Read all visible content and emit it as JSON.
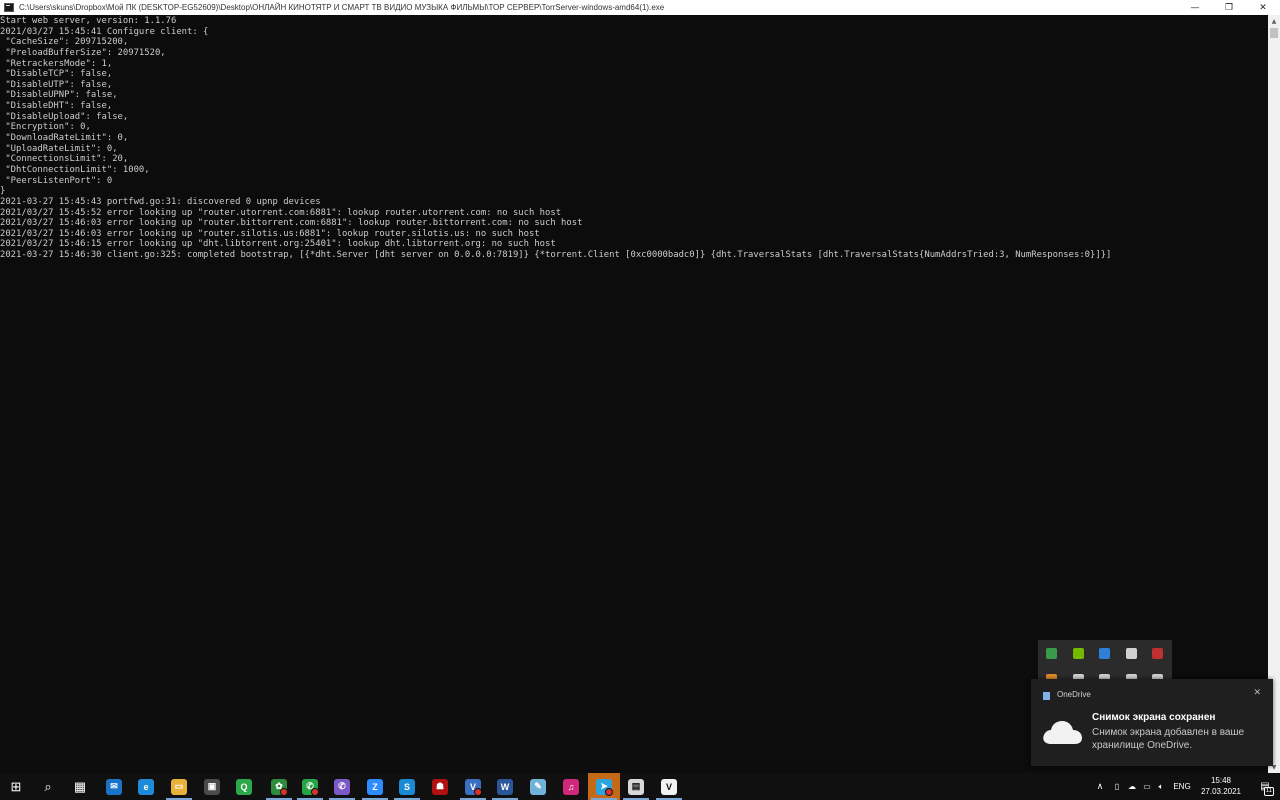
{
  "window": {
    "title": "C:\\Users\\skuns\\Dropbox\\Мой ПК (DESKTOP-EG52609)\\Desktop\\ОНЛАЙН   КИНОТЯТР  И СМАРТ ТВ  ВИДИО МУЗЫКА  ФИЛЬМЫ\\ТОР СЕРВЕР\\TorrServer-windows-amd64(1).exe",
    "controls": {
      "minimize": "—",
      "maximize": "❐",
      "close": "✕"
    }
  },
  "console": {
    "lines": [
      "Start web server, version: 1.1.76",
      "2021/03/27 15:45:41 Configure client: {",
      " \"CacheSize\": 209715200,",
      " \"PreloadBufferSize\": 20971520,",
      " \"RetrackersMode\": 1,",
      " \"DisableTCP\": false,",
      " \"DisableUTP\": false,",
      " \"DisableUPNP\": false,",
      " \"DisableDHT\": false,",
      " \"DisableUpload\": false,",
      " \"Encryption\": 0,",
      " \"DownloadRateLimit\": 0,",
      " \"UploadRateLimit\": 0,",
      " \"ConnectionsLimit\": 20,",
      " \"DhtConnectionLimit\": 1000,",
      " \"PeersListenPort\": 0",
      "}",
      "2021-03-27 15:45:43 portfwd.go:31: discovered 0 upnp devices",
      "2021/03/27 15:45:52 error looking up \"router.utorrent.com:6881\": lookup router.utorrent.com: no such host",
      "2021/03/27 15:46:03 error looking up \"router.bittorrent.com:6881\": lookup router.bittorrent.com: no such host",
      "2021/03/27 15:46:03 error looking up \"router.silotis.us:6881\": lookup router.silotis.us: no such host",
      "2021/03/27 15:46:15 error looking up \"dht.libtorrent.org:25401\": lookup dht.libtorrent.org: no such host",
      "2021-03-27 15:46:30 client.go:325: completed bootstrap, [{*dht.Server [dht server on 0.0.0.0:7819]} {*torrent.Client [0xc0000badc0]} {dht.TraversalStats [dht.TraversalStats{NumAddrsTried:3, NumResponses:0}]}]"
    ]
  },
  "toast": {
    "app_name": "OneDrive",
    "close": "✕",
    "title": "Снимок экрана сохранен",
    "body": "Снимок экрана добавлен в ваше хранилище OneDrive."
  },
  "tray_popup": {
    "icons": [
      "shield-icon",
      "nvidia-icon",
      "bluetooth-icon",
      "defender-icon",
      "antivirus-icon"
    ],
    "colors": [
      "#3a9a4a",
      "#76b900",
      "#2f7fd8",
      "#d0d0d0",
      "#c03030"
    ]
  },
  "taskbar": {
    "apps": [
      {
        "name": "start-button-icon",
        "glyph": "⊞",
        "color": "#101010"
      },
      {
        "name": "search-icon",
        "glyph": "⌕",
        "color": "#101010"
      },
      {
        "name": "task-view-icon",
        "glyph": "▦",
        "color": "#101010"
      },
      {
        "name": "mail-icon",
        "glyph": "✉",
        "color": "#1a73c7"
      },
      {
        "name": "edge-icon",
        "glyph": "e",
        "color": "#1e8bd8"
      },
      {
        "name": "file-explorer-icon",
        "glyph": "▭",
        "color": "#e8b23a"
      },
      {
        "name": "store-icon",
        "glyph": "▣",
        "color": "#4a4a4a"
      },
      {
        "name": "magnifier-app-icon",
        "glyph": "Q",
        "color": "#2aa84a"
      },
      {
        "name": "ladybug-app-icon",
        "glyph": "✿",
        "color": "#2e8b3a"
      },
      {
        "name": "whatsapp-icon",
        "glyph": "✆",
        "color": "#25a548"
      },
      {
        "name": "viber-icon",
        "glyph": "✆",
        "color": "#7b5ac8"
      },
      {
        "name": "zoom-icon",
        "glyph": "Z",
        "color": "#2d8cff"
      },
      {
        "name": "skype-icon",
        "glyph": "S",
        "color": "#1a8ad4"
      },
      {
        "name": "gaming-app-icon",
        "glyph": "☗",
        "color": "#b01010"
      },
      {
        "name": "vk-icon",
        "glyph": "V",
        "color": "#3a6fc4"
      },
      {
        "name": "word-icon",
        "glyph": "W",
        "color": "#2b579a"
      },
      {
        "name": "notes-app-icon",
        "glyph": "✎",
        "color": "#6fb3d9"
      },
      {
        "name": "music-app-icon",
        "glyph": "♫",
        "color": "#d0287a"
      },
      {
        "name": "telegram-icon",
        "glyph": "➤",
        "color": "#2aa3df"
      },
      {
        "name": "terminal-app-icon",
        "glyph": "▤",
        "color": "#d8d8d8"
      },
      {
        "name": "vegas-app-icon",
        "glyph": "V",
        "color": "#f2f2f2"
      }
    ],
    "tray": {
      "chevron": "∧",
      "language": "ENG",
      "time": "15:48",
      "date": "27.03.2021",
      "notifications_count": "11"
    }
  }
}
